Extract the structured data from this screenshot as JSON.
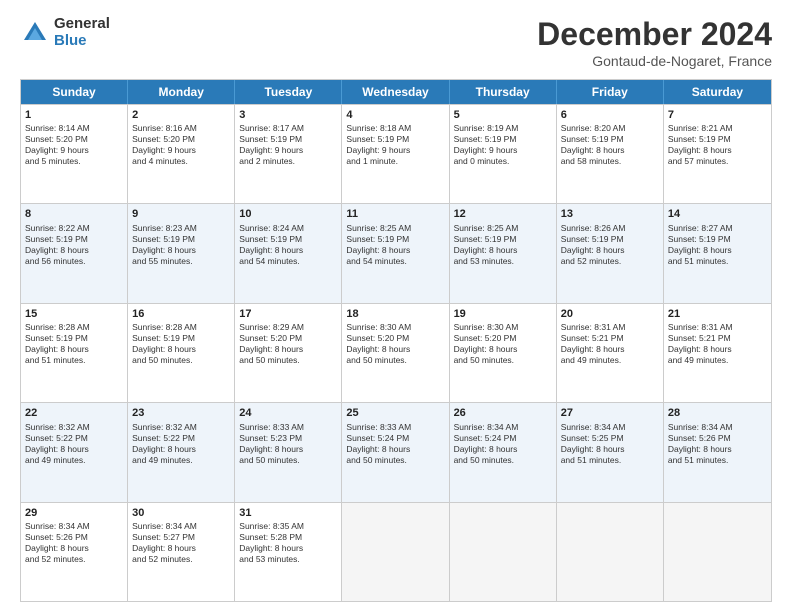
{
  "logo": {
    "general": "General",
    "blue": "Blue"
  },
  "header": {
    "month": "December 2024",
    "location": "Gontaud-de-Nogaret, France"
  },
  "days": [
    "Sunday",
    "Monday",
    "Tuesday",
    "Wednesday",
    "Thursday",
    "Friday",
    "Saturday"
  ],
  "rows": [
    [
      {
        "day": "1",
        "lines": [
          "Sunrise: 8:14 AM",
          "Sunset: 5:20 PM",
          "Daylight: 9 hours",
          "and 5 minutes."
        ]
      },
      {
        "day": "2",
        "lines": [
          "Sunrise: 8:16 AM",
          "Sunset: 5:20 PM",
          "Daylight: 9 hours",
          "and 4 minutes."
        ]
      },
      {
        "day": "3",
        "lines": [
          "Sunrise: 8:17 AM",
          "Sunset: 5:19 PM",
          "Daylight: 9 hours",
          "and 2 minutes."
        ]
      },
      {
        "day": "4",
        "lines": [
          "Sunrise: 8:18 AM",
          "Sunset: 5:19 PM",
          "Daylight: 9 hours",
          "and 1 minute."
        ]
      },
      {
        "day": "5",
        "lines": [
          "Sunrise: 8:19 AM",
          "Sunset: 5:19 PM",
          "Daylight: 9 hours",
          "and 0 minutes."
        ]
      },
      {
        "day": "6",
        "lines": [
          "Sunrise: 8:20 AM",
          "Sunset: 5:19 PM",
          "Daylight: 8 hours",
          "and 58 minutes."
        ]
      },
      {
        "day": "7",
        "lines": [
          "Sunrise: 8:21 AM",
          "Sunset: 5:19 PM",
          "Daylight: 8 hours",
          "and 57 minutes."
        ]
      }
    ],
    [
      {
        "day": "8",
        "lines": [
          "Sunrise: 8:22 AM",
          "Sunset: 5:19 PM",
          "Daylight: 8 hours",
          "and 56 minutes."
        ]
      },
      {
        "day": "9",
        "lines": [
          "Sunrise: 8:23 AM",
          "Sunset: 5:19 PM",
          "Daylight: 8 hours",
          "and 55 minutes."
        ]
      },
      {
        "day": "10",
        "lines": [
          "Sunrise: 8:24 AM",
          "Sunset: 5:19 PM",
          "Daylight: 8 hours",
          "and 54 minutes."
        ]
      },
      {
        "day": "11",
        "lines": [
          "Sunrise: 8:25 AM",
          "Sunset: 5:19 PM",
          "Daylight: 8 hours",
          "and 54 minutes."
        ]
      },
      {
        "day": "12",
        "lines": [
          "Sunrise: 8:25 AM",
          "Sunset: 5:19 PM",
          "Daylight: 8 hours",
          "and 53 minutes."
        ]
      },
      {
        "day": "13",
        "lines": [
          "Sunrise: 8:26 AM",
          "Sunset: 5:19 PM",
          "Daylight: 8 hours",
          "and 52 minutes."
        ]
      },
      {
        "day": "14",
        "lines": [
          "Sunrise: 8:27 AM",
          "Sunset: 5:19 PM",
          "Daylight: 8 hours",
          "and 51 minutes."
        ]
      }
    ],
    [
      {
        "day": "15",
        "lines": [
          "Sunrise: 8:28 AM",
          "Sunset: 5:19 PM",
          "Daylight: 8 hours",
          "and 51 minutes."
        ]
      },
      {
        "day": "16",
        "lines": [
          "Sunrise: 8:28 AM",
          "Sunset: 5:19 PM",
          "Daylight: 8 hours",
          "and 50 minutes."
        ]
      },
      {
        "day": "17",
        "lines": [
          "Sunrise: 8:29 AM",
          "Sunset: 5:20 PM",
          "Daylight: 8 hours",
          "and 50 minutes."
        ]
      },
      {
        "day": "18",
        "lines": [
          "Sunrise: 8:30 AM",
          "Sunset: 5:20 PM",
          "Daylight: 8 hours",
          "and 50 minutes."
        ]
      },
      {
        "day": "19",
        "lines": [
          "Sunrise: 8:30 AM",
          "Sunset: 5:20 PM",
          "Daylight: 8 hours",
          "and 50 minutes."
        ]
      },
      {
        "day": "20",
        "lines": [
          "Sunrise: 8:31 AM",
          "Sunset: 5:21 PM",
          "Daylight: 8 hours",
          "and 49 minutes."
        ]
      },
      {
        "day": "21",
        "lines": [
          "Sunrise: 8:31 AM",
          "Sunset: 5:21 PM",
          "Daylight: 8 hours",
          "and 49 minutes."
        ]
      }
    ],
    [
      {
        "day": "22",
        "lines": [
          "Sunrise: 8:32 AM",
          "Sunset: 5:22 PM",
          "Daylight: 8 hours",
          "and 49 minutes."
        ]
      },
      {
        "day": "23",
        "lines": [
          "Sunrise: 8:32 AM",
          "Sunset: 5:22 PM",
          "Daylight: 8 hours",
          "and 49 minutes."
        ]
      },
      {
        "day": "24",
        "lines": [
          "Sunrise: 8:33 AM",
          "Sunset: 5:23 PM",
          "Daylight: 8 hours",
          "and 50 minutes."
        ]
      },
      {
        "day": "25",
        "lines": [
          "Sunrise: 8:33 AM",
          "Sunset: 5:24 PM",
          "Daylight: 8 hours",
          "and 50 minutes."
        ]
      },
      {
        "day": "26",
        "lines": [
          "Sunrise: 8:34 AM",
          "Sunset: 5:24 PM",
          "Daylight: 8 hours",
          "and 50 minutes."
        ]
      },
      {
        "day": "27",
        "lines": [
          "Sunrise: 8:34 AM",
          "Sunset: 5:25 PM",
          "Daylight: 8 hours",
          "and 51 minutes."
        ]
      },
      {
        "day": "28",
        "lines": [
          "Sunrise: 8:34 AM",
          "Sunset: 5:26 PM",
          "Daylight: 8 hours",
          "and 51 minutes."
        ]
      }
    ],
    [
      {
        "day": "29",
        "lines": [
          "Sunrise: 8:34 AM",
          "Sunset: 5:26 PM",
          "Daylight: 8 hours",
          "and 52 minutes."
        ]
      },
      {
        "day": "30",
        "lines": [
          "Sunrise: 8:34 AM",
          "Sunset: 5:27 PM",
          "Daylight: 8 hours",
          "and 52 minutes."
        ]
      },
      {
        "day": "31",
        "lines": [
          "Sunrise: 8:35 AM",
          "Sunset: 5:28 PM",
          "Daylight: 8 hours",
          "and 53 minutes."
        ]
      },
      {
        "day": "",
        "lines": []
      },
      {
        "day": "",
        "lines": []
      },
      {
        "day": "",
        "lines": []
      },
      {
        "day": "",
        "lines": []
      }
    ]
  ]
}
